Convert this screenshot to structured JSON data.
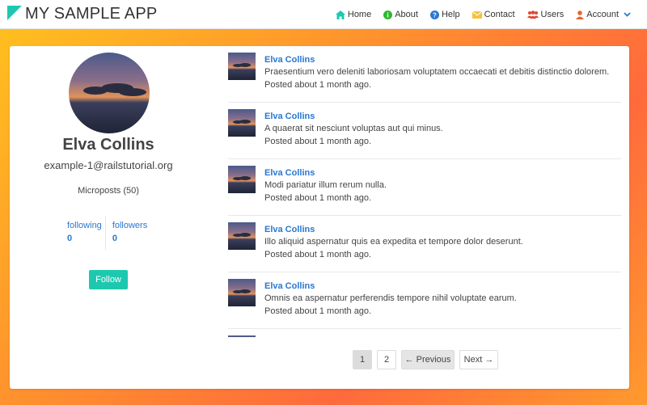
{
  "app": {
    "brand": "MY SAMPLE APP"
  },
  "nav": {
    "home": "Home",
    "about": "About",
    "help": "Help",
    "contact": "Contact",
    "users": "Users",
    "account": "Account"
  },
  "profile": {
    "name": "Elva Collins",
    "email": "example-1@railstutorial.org",
    "microposts": "Microposts (50)",
    "following_label": "following",
    "following_count": "0",
    "followers_label": "followers",
    "followers_count": "0",
    "follow_button": "Follow"
  },
  "feed": [
    {
      "user": "Elva Collins",
      "content": "Praesentium vero deleniti laboriosam voluptatem occaecati et debitis distinctio dolorem.",
      "time": "Posted about 1 month ago."
    },
    {
      "user": "Elva Collins",
      "content": "A quaerat sit nesciunt voluptas aut qui minus.",
      "time": "Posted about 1 month ago."
    },
    {
      "user": "Elva Collins",
      "content": "Modi pariatur illum rerum nulla.",
      "time": "Posted about 1 month ago."
    },
    {
      "user": "Elva Collins",
      "content": "Illo aliquid aspernatur quis ea expedita et tempore dolor deserunt.",
      "time": "Posted about 1 month ago."
    },
    {
      "user": "Elva Collins",
      "content": "Omnis ea aspernatur perferendis tempore nihil voluptate earum.",
      "time": "Posted about 1 month ago."
    }
  ],
  "pagination": {
    "page1": "1",
    "page2": "2",
    "previous": "← Previous",
    "next": "Next →"
  },
  "colors": {
    "accent": "#1ec8b0",
    "link": "#2a77d0",
    "home_icon": "#1ec8b0",
    "about_icon": "#2eb82e",
    "help_icon": "#2a77d0",
    "contact_icon": "#f5c23e",
    "users_icon": "#e0452e",
    "account_icon": "#e8642c"
  }
}
